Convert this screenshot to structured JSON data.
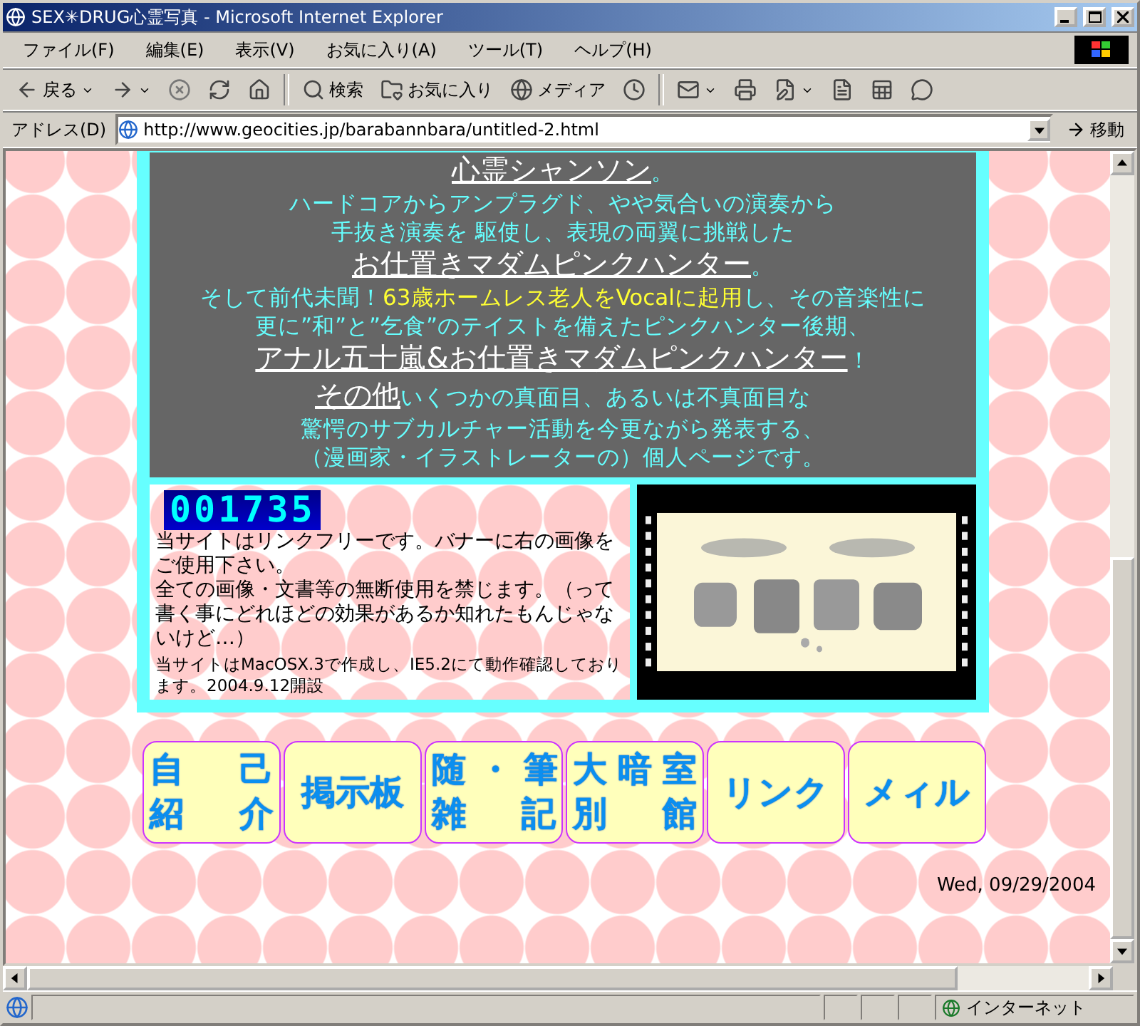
{
  "window": {
    "title": "SEX✳DRUG心霊写真 - Microsoft Internet Explorer"
  },
  "menu": [
    "ファイル(F)",
    "編集(E)",
    "表示(V)",
    "お気に入り(A)",
    "ツール(T)",
    "ヘルプ(H)"
  ],
  "toolbar": [
    {
      "kind": "back",
      "label": "戻る",
      "dropdown": true
    },
    {
      "kind": "forward",
      "dropdown": true
    },
    {
      "kind": "stop"
    },
    {
      "kind": "refresh"
    },
    {
      "kind": "home"
    },
    {
      "kind": "search",
      "label": "検索"
    },
    {
      "kind": "favorites",
      "label": "お気に入り"
    },
    {
      "kind": "media",
      "label": "メディア"
    },
    {
      "kind": "history"
    },
    {
      "kind": "mail",
      "dropdown": true
    },
    {
      "kind": "print"
    },
    {
      "kind": "edit",
      "dropdown": true
    },
    {
      "kind": "discuss"
    },
    {
      "kind": "research"
    },
    {
      "kind": "messenger"
    }
  ],
  "address": {
    "label": "アドレス(D)",
    "url": "http://www.geocities.jp/barabannbara/untitled-2.html",
    "go": "移動"
  },
  "intro": [
    [
      {
        "kind": "heading",
        "text": "心霊シャンソン"
      },
      {
        "kind": "cyan",
        "text": "。"
      }
    ],
    [
      {
        "kind": "cyan",
        "text": "ハードコアからアンプラグド、やや気合いの演奏から"
      }
    ],
    [
      {
        "kind": "cyan",
        "text": "手抜き演奏を 駆使し、表現の両翼に挑戦した"
      }
    ],
    [
      {
        "kind": "heading",
        "text": "お仕置きマダムピンクハンター"
      },
      {
        "kind": "cyan",
        "text": "。"
      }
    ],
    [
      {
        "kind": "cyan",
        "text": "そして前代未聞！"
      },
      {
        "kind": "yellow",
        "text": "63歳ホームレス老人をVocalに起用"
      },
      {
        "kind": "cyan",
        "text": "し、その音楽性に"
      }
    ],
    [
      {
        "kind": "cyan",
        "text": "更に”和”と”乞食”のテイストを備えたピンクハンター後期、"
      }
    ],
    [
      {
        "kind": "heading",
        "text": "アナル五十嵐&お仕置きマダムピンクハンター"
      },
      {
        "kind": "cyan",
        "text": "！"
      }
    ],
    [
      {
        "kind": "heading",
        "text": "その他"
      },
      {
        "kind": "cyan",
        "text": "いくつかの真面目、あるいは不真面目な"
      }
    ],
    [
      {
        "kind": "cyan",
        "text": "驚愕のサブカルチャー活動を今更ながら発表する、"
      }
    ],
    [
      {
        "kind": "cyan",
        "text": "（漫画家・イラストレーターの）個人ページです。"
      }
    ]
  ],
  "counter": "001735",
  "notices": [
    "当サイトはリンクフリーです。バナーに右の画像をご使用下さい。",
    "全ての画像・文書等の無断使用を禁じます。（って書く事にどれほどの効果があるか知れたもんじゃないけど…）"
  ],
  "small_note": "当サイトはMacOSX.3で作成し、IE5.2にて動作確認しております。2004.9.12開設",
  "banner": {
    "kind": "picture"
  },
  "nav": [
    {
      "lines": [
        "自 己",
        "紹 介"
      ]
    },
    {
      "lines": [
        "掲示板"
      ]
    },
    {
      "lines": [
        "随 ・ 筆",
        "雑 記"
      ]
    },
    {
      "lines": [
        "大暗室",
        "別 館"
      ]
    },
    {
      "lines": [
        "リンク"
      ]
    },
    {
      "lines": [
        "メィル"
      ]
    }
  ],
  "date": "Wed, 09/29/2004",
  "status": {
    "zone": "インターネット"
  }
}
